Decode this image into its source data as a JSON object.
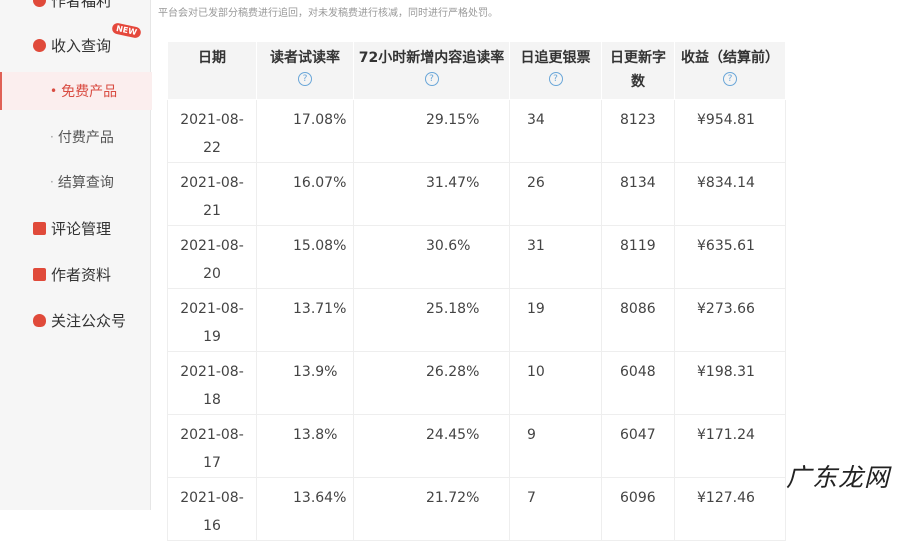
{
  "sidebar": {
    "items": [
      {
        "label": "作者福利",
        "icon": "circle-badge-icon"
      },
      {
        "label": "收入查询",
        "icon": "circle-badge-icon",
        "badge": "NEW"
      },
      {
        "label": "免费产品",
        "sub": true,
        "active": true
      },
      {
        "label": "付费产品",
        "sub": true
      },
      {
        "label": "结算查询",
        "sub": true
      },
      {
        "label": "评论管理",
        "icon": "square-icon"
      },
      {
        "label": "作者资料",
        "icon": "square-icon"
      },
      {
        "label": "关注公众号",
        "icon": "heart-icon"
      }
    ]
  },
  "notice": {
    "line2": "平台会对已发部分稿费进行追回，对未发稿费进行核减，同时进行严格处罚。"
  },
  "table": {
    "headers": [
      {
        "line1": "日期",
        "line2": ""
      },
      {
        "line1": "读者试读率",
        "line2": "?"
      },
      {
        "line1": "72小时新增内容追读率",
        "line2": "?"
      },
      {
        "line1": "日追更银票",
        "line2": "?"
      },
      {
        "line1": "日更新字",
        "line2": "数"
      },
      {
        "line1": "收益（结算前）",
        "line2": "?"
      }
    ],
    "rows": [
      {
        "date1": "2021-08-",
        "date2": "22",
        "read": "17.08%",
        "follow72": "29.15%",
        "tickets": "34",
        "words": "8123",
        "income": "¥954.81"
      },
      {
        "date1": "2021-08-",
        "date2": "21",
        "read": "16.07%",
        "follow72": "31.47%",
        "tickets": "26",
        "words": "8134",
        "income": "¥834.14"
      },
      {
        "date1": "2021-08-",
        "date2": "20",
        "read": "15.08%",
        "follow72": "30.6%",
        "tickets": "31",
        "words": "8119",
        "income": "¥635.61"
      },
      {
        "date1": "2021-08-",
        "date2": "19",
        "read": "13.71%",
        "follow72": "25.18%",
        "tickets": "19",
        "words": "8086",
        "income": "¥273.66"
      },
      {
        "date1": "2021-08-",
        "date2": "18",
        "read": "13.9%",
        "follow72": "26.28%",
        "tickets": "10",
        "words": "6048",
        "income": "¥198.31"
      },
      {
        "date1": "2021-08-",
        "date2": "17",
        "read": "13.8%",
        "follow72": "24.45%",
        "tickets": "9",
        "words": "6047",
        "income": "¥171.24"
      },
      {
        "date1": "2021-08-",
        "date2": "16",
        "read": "13.64%",
        "follow72": "21.72%",
        "tickets": "7",
        "words": "6096",
        "income": "¥127.46"
      }
    ]
  },
  "watermark": "广东龙网"
}
